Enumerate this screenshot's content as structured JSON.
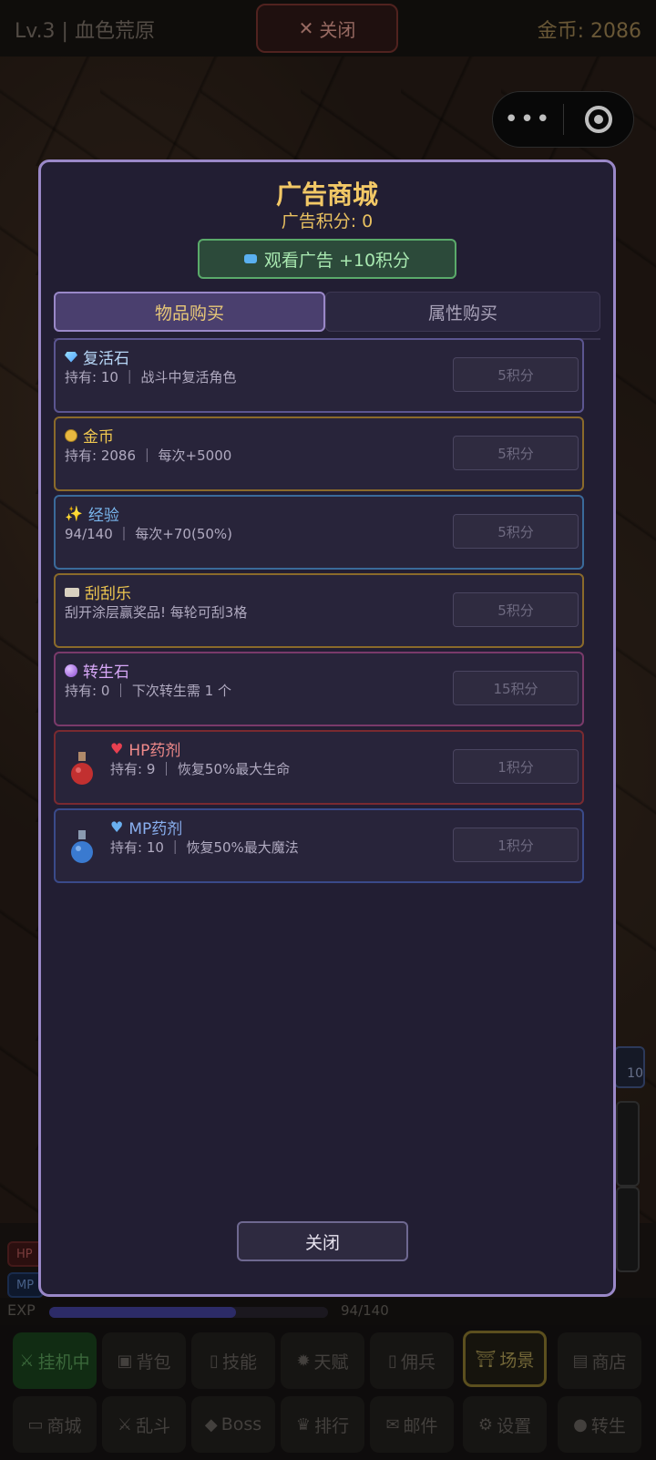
{
  "topbar": {
    "level": "Lv.3 | 血色荒原",
    "close_label": "关闭",
    "gold": "金币: 2086"
  },
  "capsule": {
    "more_label": "•••"
  },
  "side": {
    "potion_count": "10",
    "hp_label": "HP",
    "mp_label": "MP"
  },
  "exp": {
    "label": "EXP",
    "text": "94/140",
    "progress": 0.671
  },
  "modal": {
    "title": "广告商城",
    "points": "广告积分: 0",
    "watch_label": "观看广告 +10积分",
    "tabs": [
      "物品购买",
      "属性购买"
    ],
    "items": [
      {
        "name": "复活石",
        "desc": "持有: 10 ｜ 战斗中复活角色",
        "price": "5积分",
        "icon": "diamond-icon",
        "name_color": "#b8d8f8",
        "border": "#5b5590"
      },
      {
        "name": "金币",
        "desc": "持有: 2086 ｜ 每次+5000",
        "price": "5积分",
        "icon": "coin-icon",
        "name_color": "#f0c850",
        "border": "#8a6a2a"
      },
      {
        "name": "经验",
        "desc": "94/140 ｜ 每次+70(50%)",
        "price": "5积分",
        "icon": "sparkles-icon",
        "name_color": "#7ab8f0",
        "border": "#3a6a9a"
      },
      {
        "name": "刮刮乐",
        "desc": "刮开涂层赢奖品! 每轮可刮3格",
        "price": "5积分",
        "icon": "ticket-icon",
        "name_color": "#f0c850",
        "border": "#8a6a2a"
      },
      {
        "name": "转生石",
        "desc": "持有: 0 ｜ 下次转生需 1 个",
        "price": "15积分",
        "icon": "crystal-ball-icon",
        "name_color": "#d8a8f8",
        "border": "#7a3a6a"
      },
      {
        "name": "HP药剂",
        "desc": "持有: 9 ｜ 恢复50%最大生命",
        "price": "1积分",
        "icon": "red-heart-icon",
        "name_color": "#f08a8a",
        "border": "#7a2a30"
      },
      {
        "name": "MP药剂",
        "desc": "持有: 10 ｜ 恢复50%最大魔法",
        "price": "1积分",
        "icon": "blue-heart-icon",
        "name_color": "#8ab0f0",
        "border": "#3a4a8a"
      }
    ],
    "close_label": "关闭"
  },
  "nav": {
    "row1": [
      "挂机中",
      "背包",
      "技能",
      "天赋",
      "佣兵",
      "场景",
      "商店"
    ],
    "row2": [
      "商城",
      "乱斗",
      "Boss",
      "排行",
      "邮件",
      "设置",
      "转生"
    ]
  }
}
